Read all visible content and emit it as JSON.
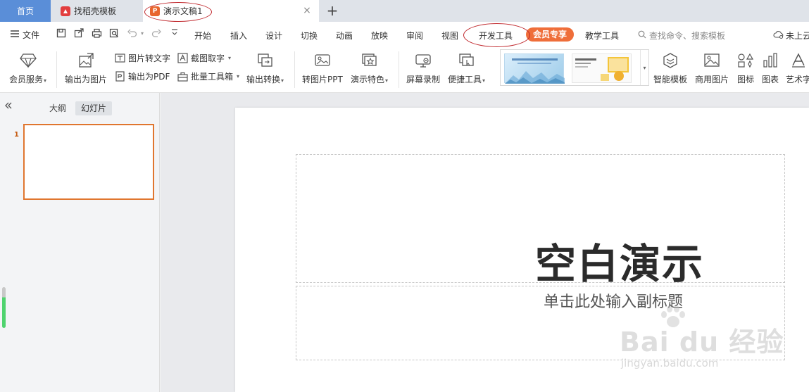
{
  "tabs": {
    "home": "首页",
    "template": "找稻壳模板",
    "doc": "演示文稿1",
    "close_glyph": "×",
    "add_glyph": "+"
  },
  "menu": {
    "file": "文件",
    "items": [
      "开始",
      "插入",
      "设计",
      "切换",
      "动画",
      "放映",
      "审阅",
      "视图",
      "开发工具",
      "会员专享",
      "教学工具"
    ],
    "search_placeholder": "查找命令、搜索模板",
    "cloud": "未上云"
  },
  "ribbon": {
    "vip_service": "会员服务",
    "export_image": "输出为图片",
    "image_to_text": "图片转文字",
    "export_pdf": "输出为PDF",
    "screenshot_ocr": "截图取字",
    "batch_toolbox": "批量工具箱",
    "export_convert": "输出转换",
    "image_to_ppt": "转图片PPT",
    "presentation_features": "演示特色",
    "screen_record": "屏幕录制",
    "quick_tools": "便捷工具",
    "smart_template": "智能模板",
    "commercial_images": "商用图片",
    "icons": "图标",
    "charts": "图表",
    "art_text": "艺术字"
  },
  "panel": {
    "outline_tab": "大纲",
    "slides_tab": "幻灯片",
    "slide_number": "1"
  },
  "slide": {
    "title": "空白演示",
    "subtitle": "单击此处输入副标题"
  },
  "watermark": {
    "brand": "Bai du 经验",
    "url": "jingyan.baidu.com"
  },
  "colors": {
    "home_tab": "#5a8ed8",
    "vip_pill": "#ef6e3a",
    "annotation": "#c0282d",
    "slide_selected": "#e0762f"
  }
}
